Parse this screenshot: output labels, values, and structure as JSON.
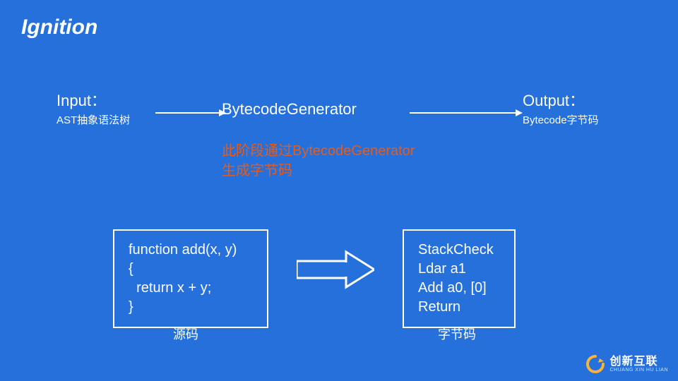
{
  "title": "Ignition",
  "flow": {
    "input": {
      "title": "Input：",
      "sub": "AST抽象语法树"
    },
    "center": "BytecodeGenerator",
    "output": {
      "title": "Output：",
      "sub": "Bytecode字节码"
    }
  },
  "annotation": "此阶段通过BytecodeGenerator\n生成字节码",
  "source_code": "function add(x, y)\n{\n  return x + y;\n}",
  "byte_code": "StackCheck\nLdar a1\nAdd a0, [0]\nReturn",
  "captions": {
    "source": "源码",
    "bytecode": "字节码"
  },
  "logo": {
    "cn": "创新互联",
    "py": "CHUANG XIN HU LIAN"
  }
}
